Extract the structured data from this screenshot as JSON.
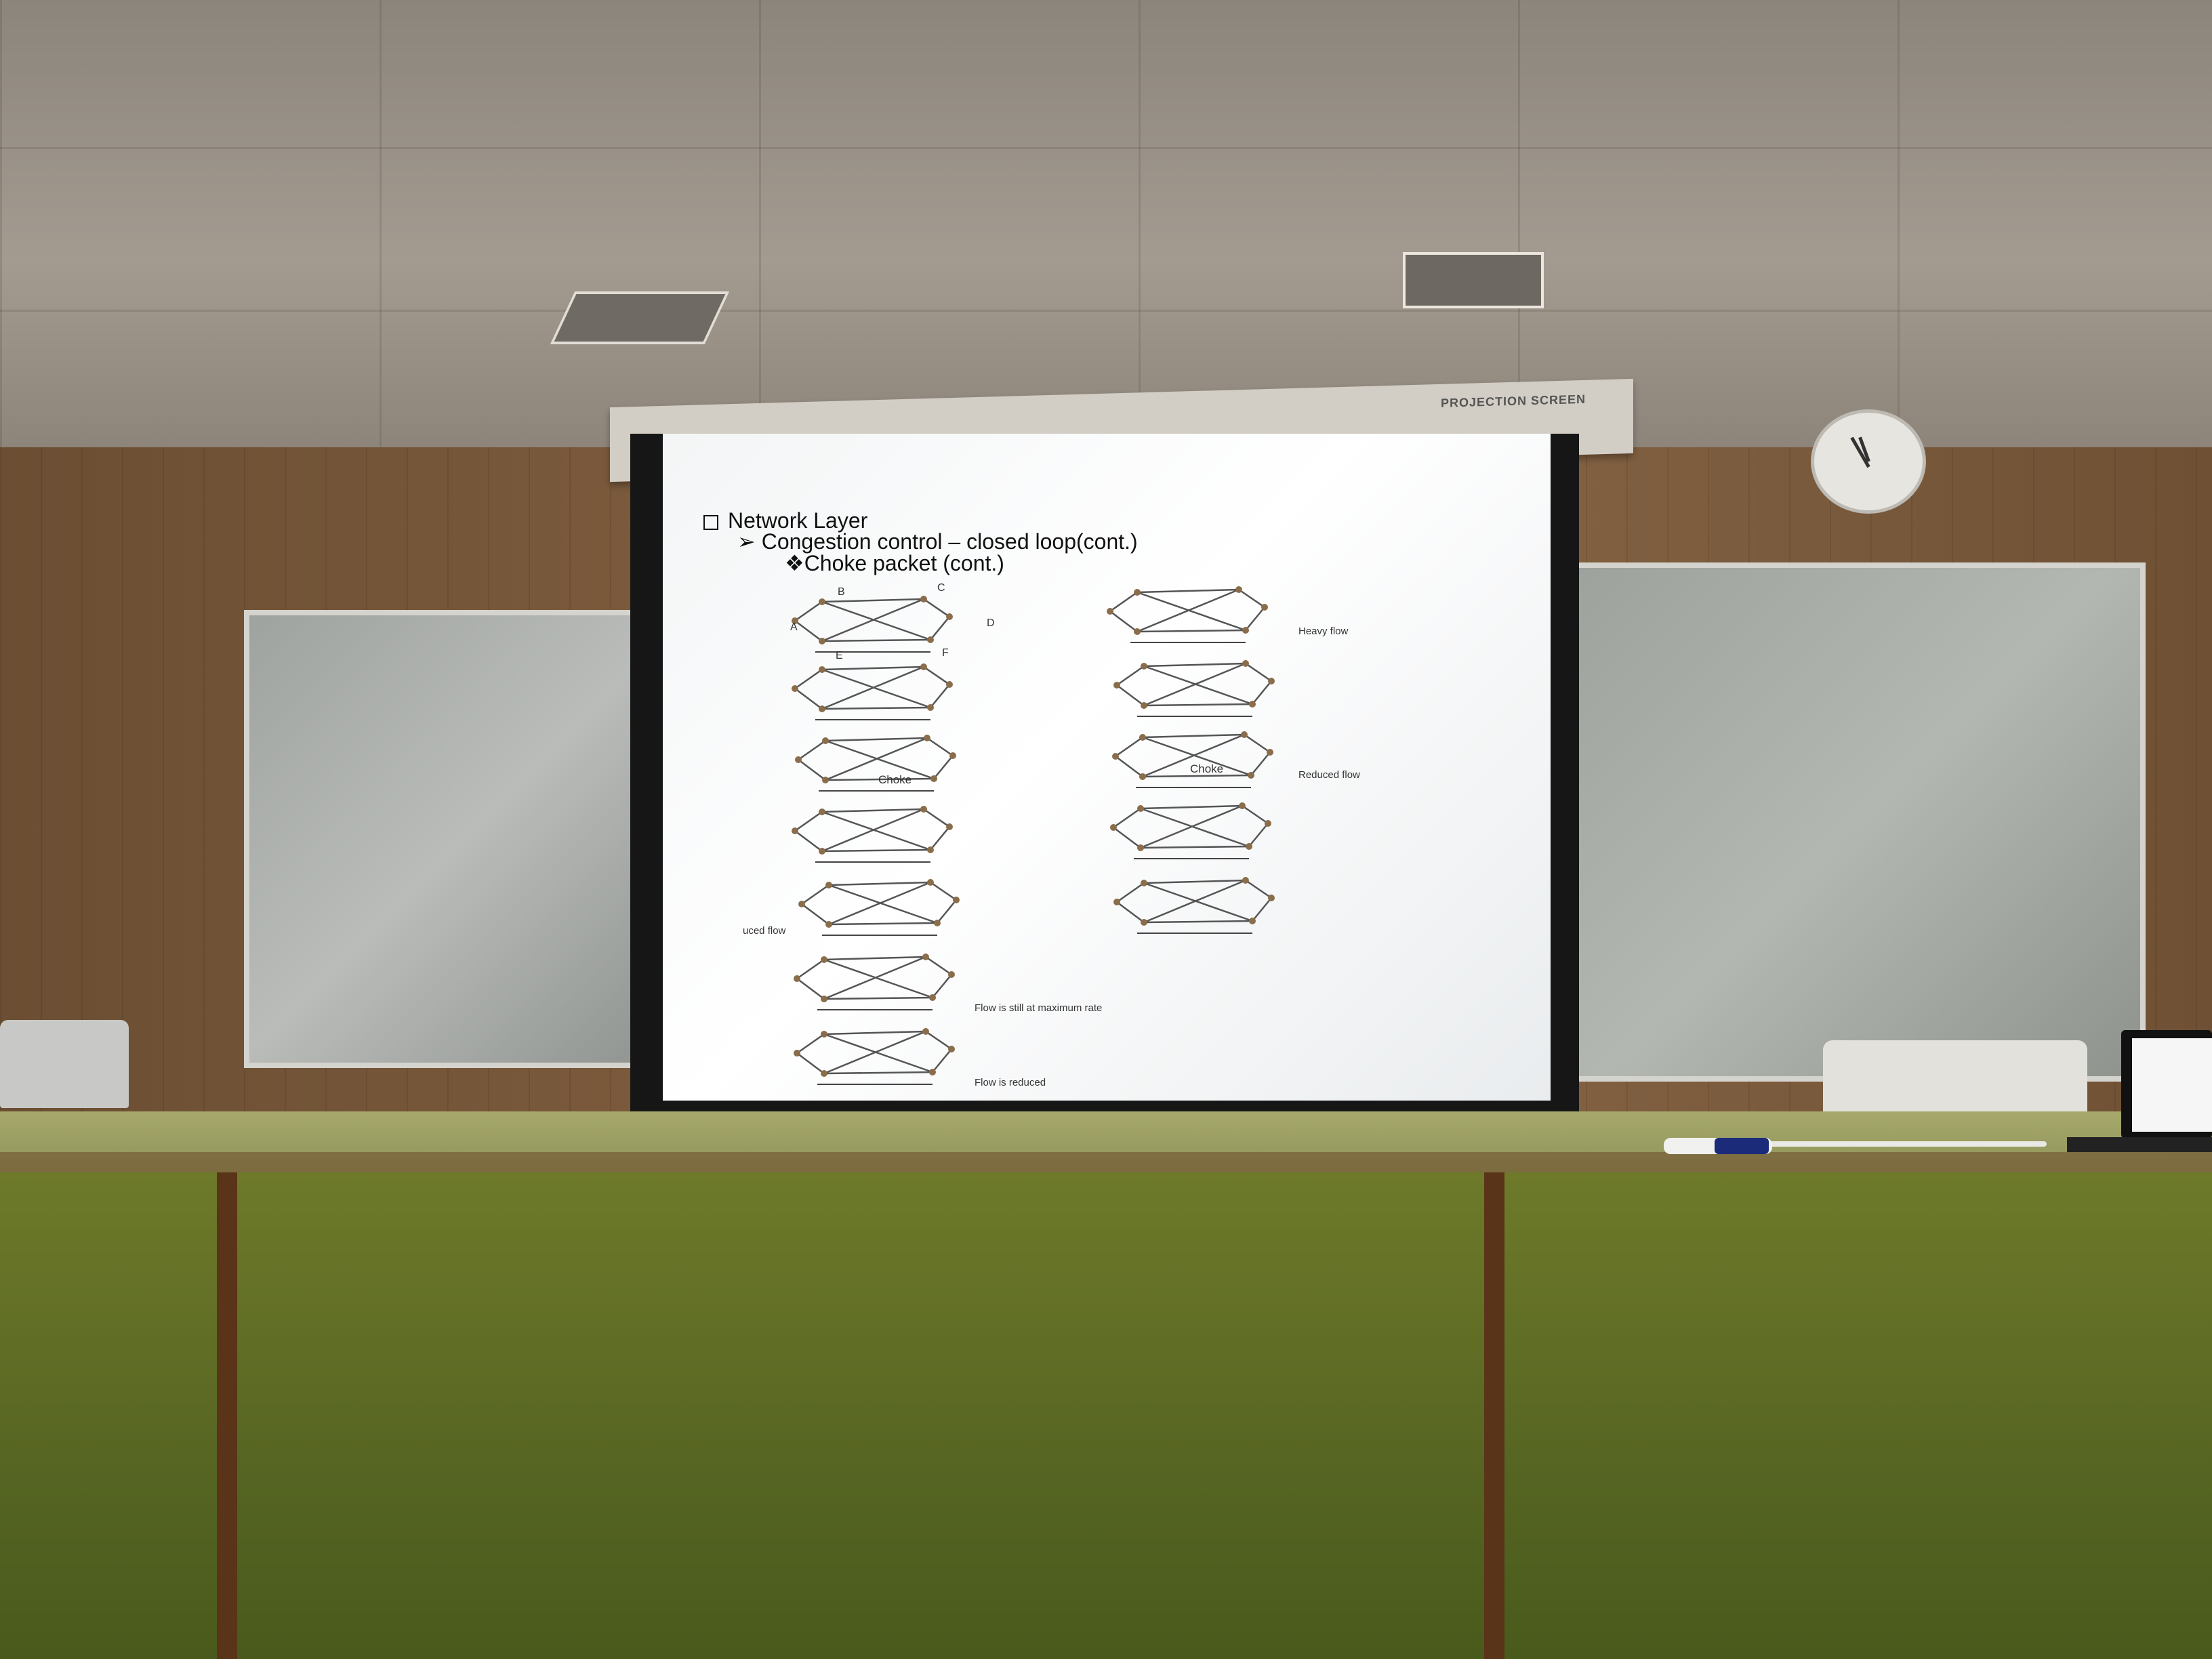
{
  "scene": {
    "screen_brand": "PROJECTION SCREEN"
  },
  "slide": {
    "heading": "Network Layer",
    "subheading": "Congestion control – closed loop(cont.)",
    "topic": "❖Choke packet (cont.)",
    "node_labels": {
      "a": "A",
      "b": "B",
      "c": "C",
      "d": "D",
      "e": "E",
      "f": "F"
    },
    "left_column": {
      "choke_label": "Choke",
      "side_label": "uced flow",
      "note_max": "Flow is still at maximum rate",
      "note_reduced": "Flow is reduced"
    },
    "right_column": {
      "heavy_flow": "Heavy flow",
      "choke_label": "Choke",
      "reduced_flow": "Reduced flow"
    }
  },
  "colors": {
    "slide_bg": "#ffffff",
    "node": "#8a6d4a",
    "edge": "#555555",
    "desk": "#6e7a2a",
    "wall": "#7b5a3c"
  }
}
